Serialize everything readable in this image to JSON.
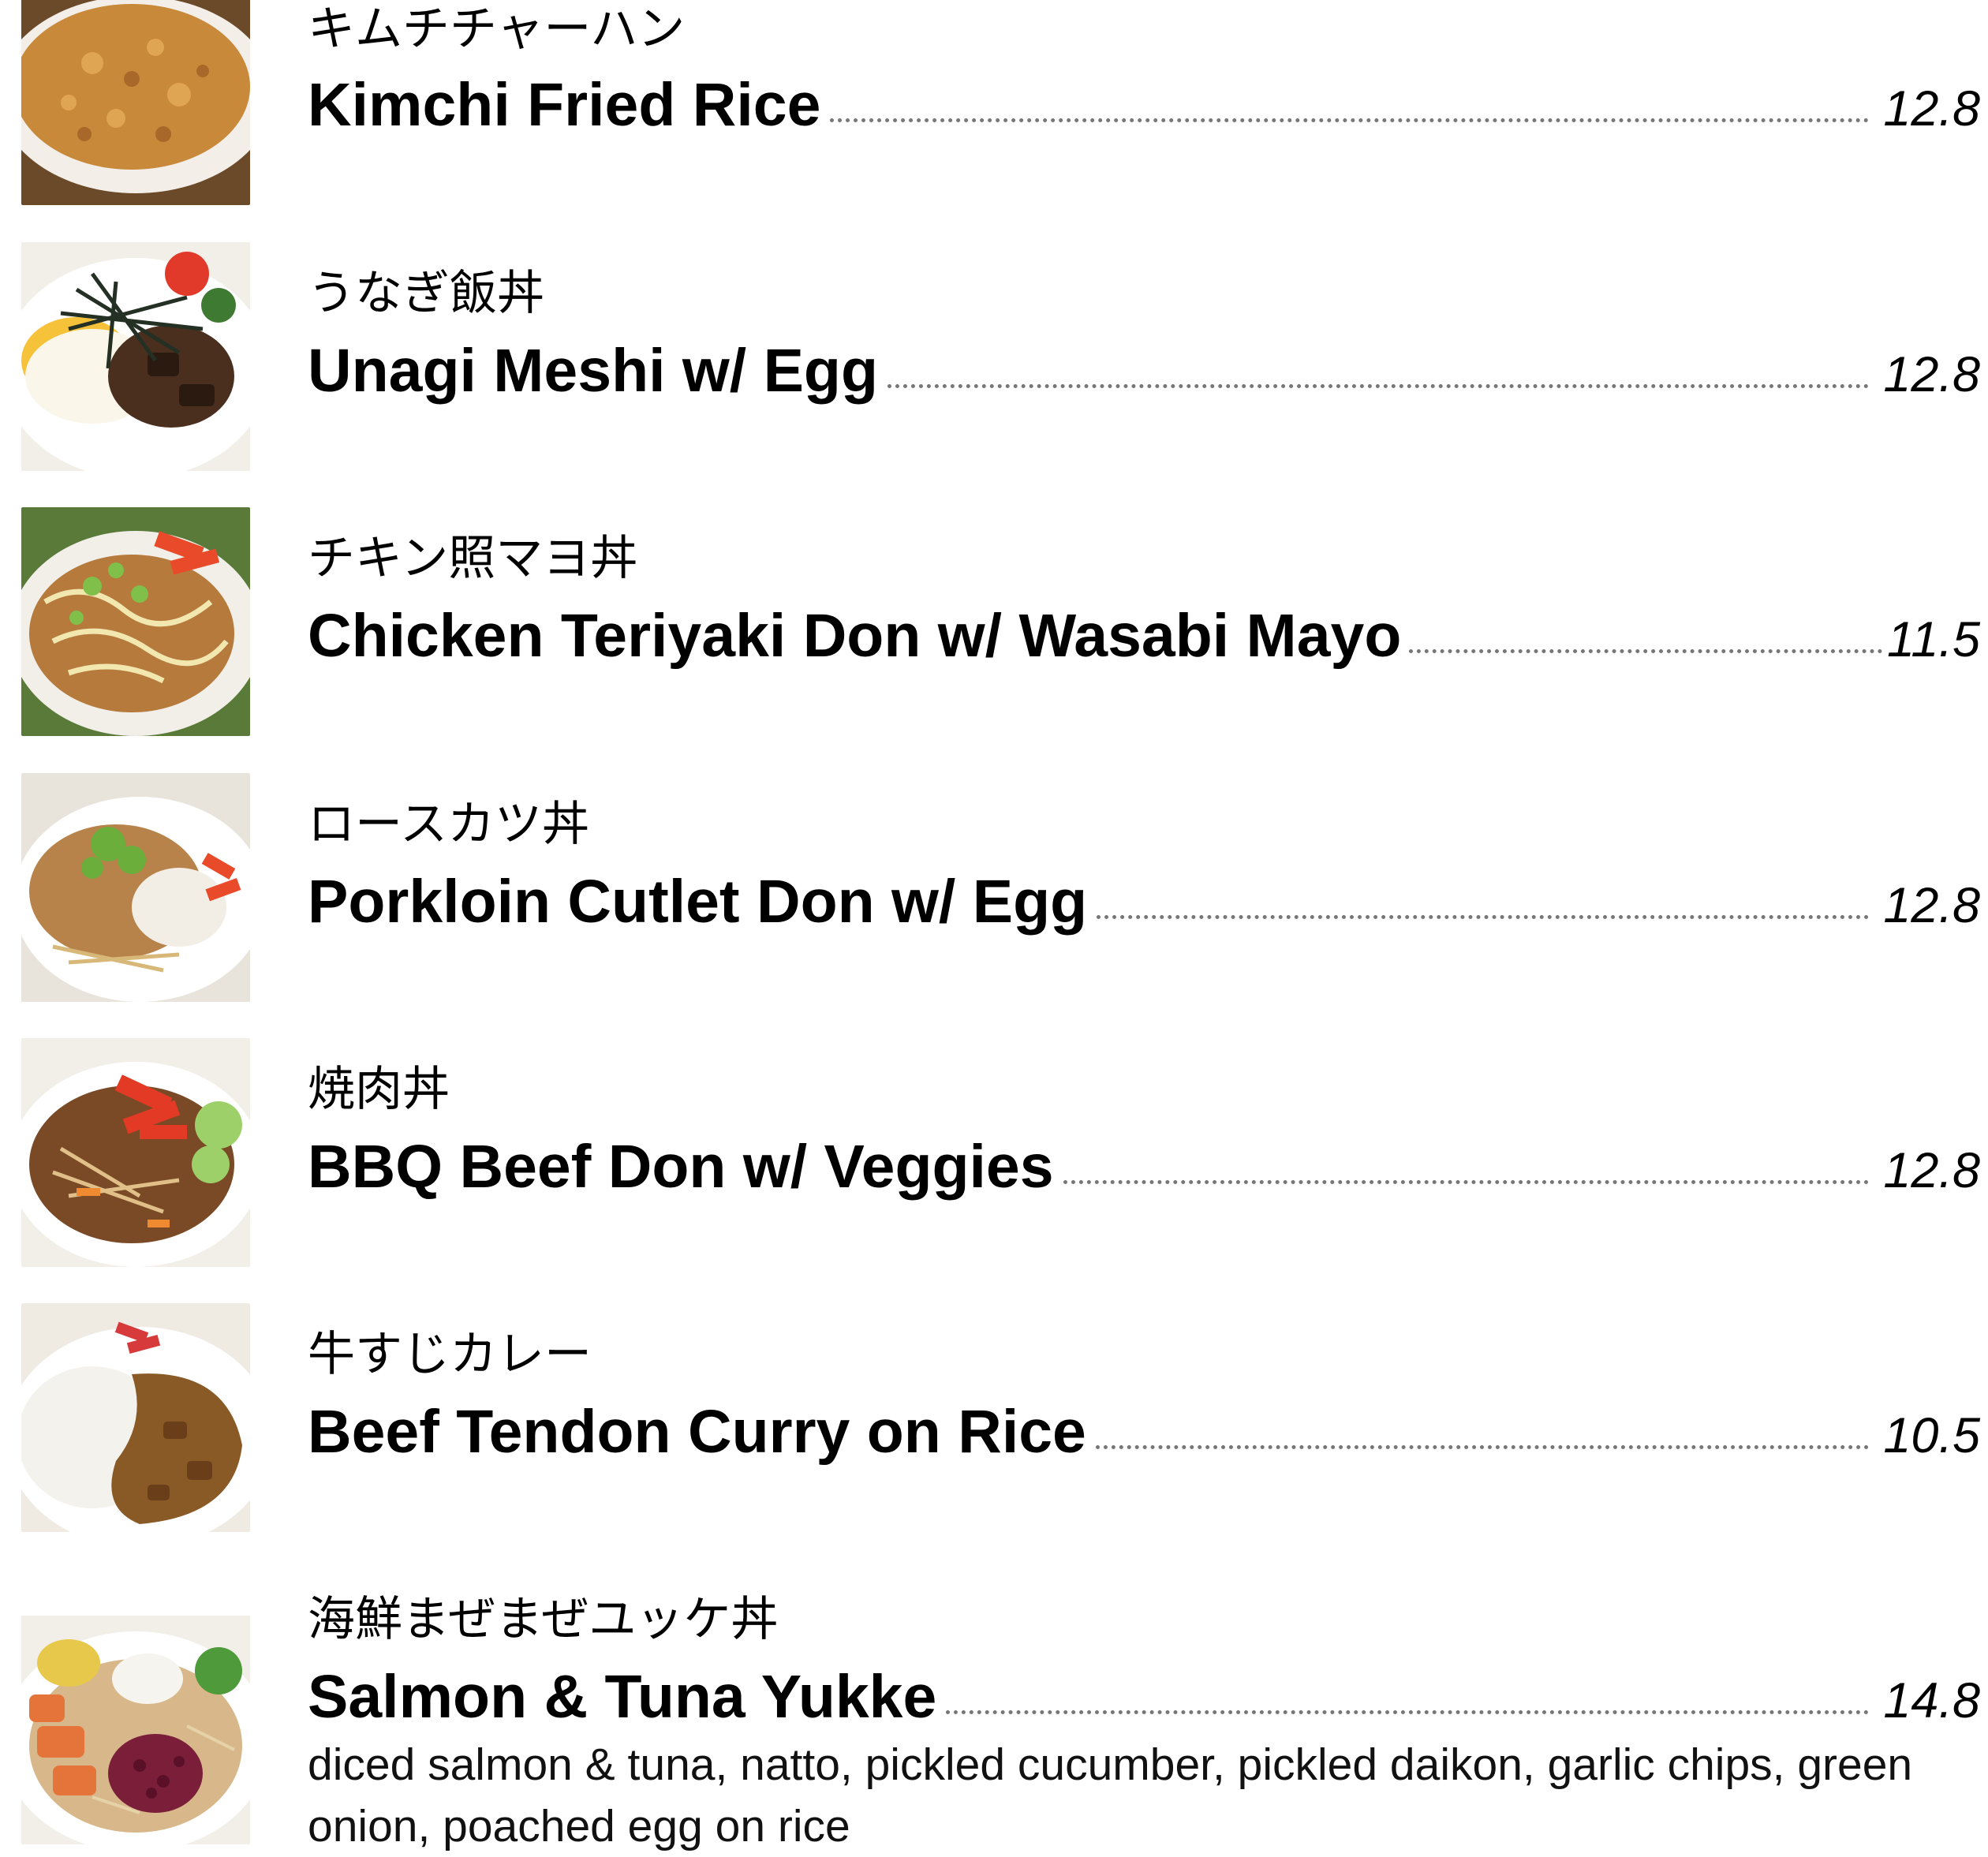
{
  "menu": {
    "items": [
      {
        "jp": "キムチチャーハン",
        "name": "Kimchi Fried Rice",
        "price": "12.8",
        "description": ""
      },
      {
        "jp": "うなぎ飯丼",
        "name": "Unagi Meshi w/ Egg",
        "price": "12.8",
        "description": ""
      },
      {
        "jp": "チキン照マヨ丼",
        "name": "Chicken Teriyaki Don w/ Wasabi Mayo",
        "price": "11.5",
        "description": ""
      },
      {
        "jp": "ロースカツ丼",
        "name": "Porkloin Cutlet Don w/ Egg",
        "price": "12.8",
        "description": ""
      },
      {
        "jp": "焼肉丼",
        "name": "BBQ Beef Don w/ Veggies",
        "price": "12.8",
        "description": ""
      },
      {
        "jp": "牛すじカレー",
        "name": "Beef Tendon Curry on Rice",
        "price": "10.5",
        "description": ""
      },
      {
        "jp": "海鮮まぜまぜユッケ丼",
        "name": "Salmon & Tuna Yukke",
        "price": "14.8",
        "description": "diced salmon & tuna, natto, pickled cucumber, pickled daikon, garlic chips, green onion, poached egg on rice"
      }
    ]
  },
  "photos": [
    {
      "icon": "kimchi-fried-rice-photo",
      "colors": [
        "#c88a3a",
        "#e0a552",
        "#a8682a"
      ]
    },
    {
      "icon": "unagi-meshi-photo",
      "colors": [
        "#4a2e1e",
        "#f4e6c8",
        "#3f7a32"
      ]
    },
    {
      "icon": "chicken-teriyaki-photo",
      "colors": [
        "#b57a3c",
        "#e84a2a",
        "#7fbf4a"
      ]
    },
    {
      "icon": "porkloin-cutlet-photo",
      "colors": [
        "#b8834a",
        "#f2eee6",
        "#6cae3c"
      ]
    },
    {
      "icon": "bbq-beef-photo",
      "colors": [
        "#7a4a26",
        "#e23a24",
        "#9ed06a"
      ]
    },
    {
      "icon": "beef-curry-photo",
      "colors": [
        "#8a5a26",
        "#f4f2ec",
        "#d63a3a"
      ]
    },
    {
      "icon": "yukke-don-photo",
      "colors": [
        "#e5743a",
        "#7a1e3a",
        "#e8c84a"
      ]
    }
  ]
}
